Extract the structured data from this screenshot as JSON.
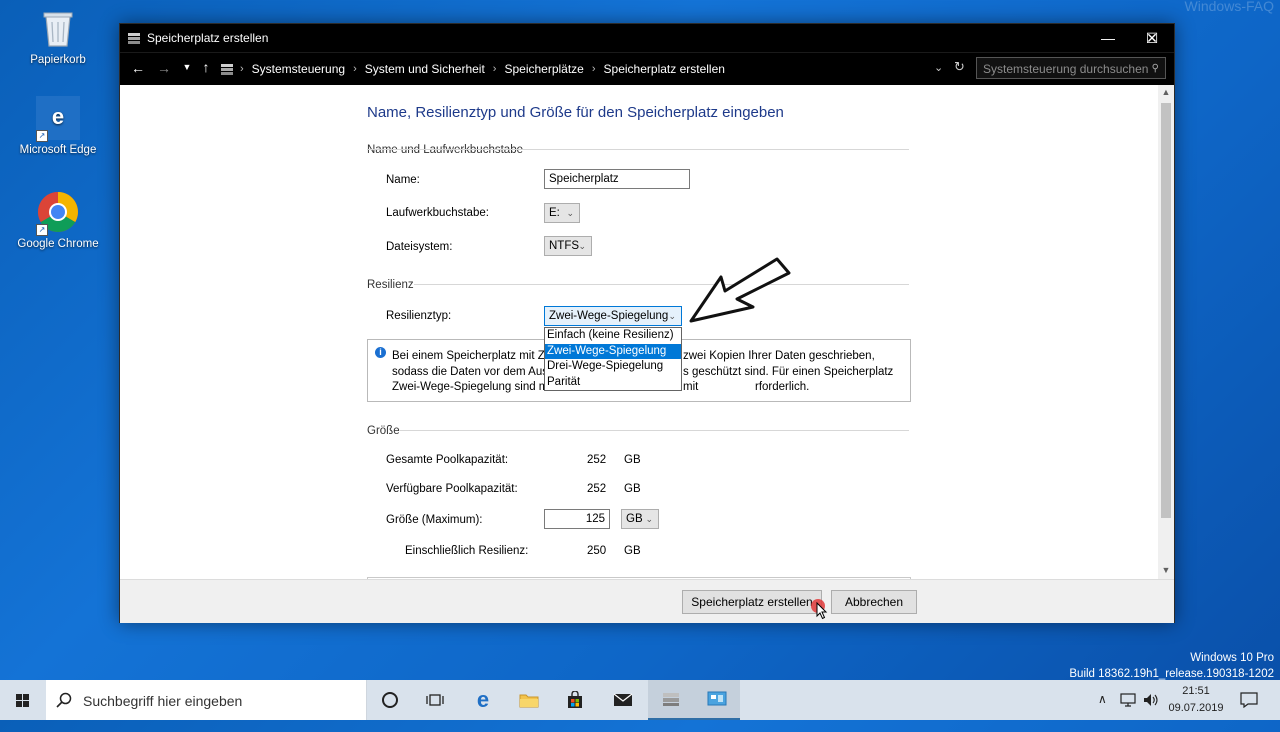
{
  "watermark": "Windows-FAQ",
  "desktop": {
    "icons": [
      {
        "label": "Papierkorb",
        "icon": "recycle-bin-icon"
      },
      {
        "label": "Microsoft Edge",
        "icon": "edge-icon"
      },
      {
        "label": "Google Chrome",
        "icon": "chrome-icon"
      }
    ]
  },
  "window": {
    "title": "Speicherplatz erstellen",
    "breadcrumbs": [
      "Systemsteuerung",
      "System und Sicherheit",
      "Speicherplätze",
      "Speicherplatz erstellen"
    ],
    "search_placeholder": "Systemsteuerung durchsuchen"
  },
  "form": {
    "heading": "Name, Resilienztyp und Größe für den Speicherplatz eingeben",
    "section_name": "Name und Laufwerkbuchstabe",
    "name_label": "Name:",
    "name_value": "Speicherplatz",
    "drive_label": "Laufwerkbuchstabe:",
    "drive_value": "E:",
    "fs_label": "Dateisystem:",
    "fs_value": "NTFS",
    "section_resilience": "Resilienz",
    "resilience_label": "Resilienztyp:",
    "resilience_value": "Zwei-Wege-Spiegelung",
    "resilience_options": [
      "Einfach (keine Resilienz)",
      "Zwei-Wege-Spiegelung",
      "Drei-Wege-Spiegelung",
      "Parität"
    ],
    "info_line1_a": "Bei einem Speicherplatz mit Zw",
    "info_line1_b": "zwei Kopien Ihrer Daten geschrieben,",
    "info_line2_a": "sodass die Daten vor dem Aus",
    "info_line2_b": "s geschützt sind. Für einen Speicherplatz mit",
    "info_line3_a": "Zwei-Wege-Spiegelung sind m",
    "info_line3_b": "rforderlich.",
    "section_size": "Größe",
    "total_label": "Gesamte Poolkapazität:",
    "total_value": "252",
    "total_unit": "GB",
    "avail_label": "Verfügbare Poolkapazität:",
    "avail_value": "252",
    "avail_unit": "GB",
    "size_label": "Größe (Maximum):",
    "size_value": "125",
    "size_unit": "GB",
    "incl_label": "Einschließlich Resilienz:",
    "incl_value": "250",
    "incl_unit": "GB"
  },
  "buttons": {
    "create": "Speicherplatz erstellen",
    "cancel": "Abbrechen"
  },
  "taskbar": {
    "search_placeholder": "Suchbegriff hier eingeben",
    "time": "21:51",
    "date": "09.07.2019",
    "os_name": "Windows 10 Pro",
    "build": "Build 18362.19h1_release.190318-1202"
  }
}
